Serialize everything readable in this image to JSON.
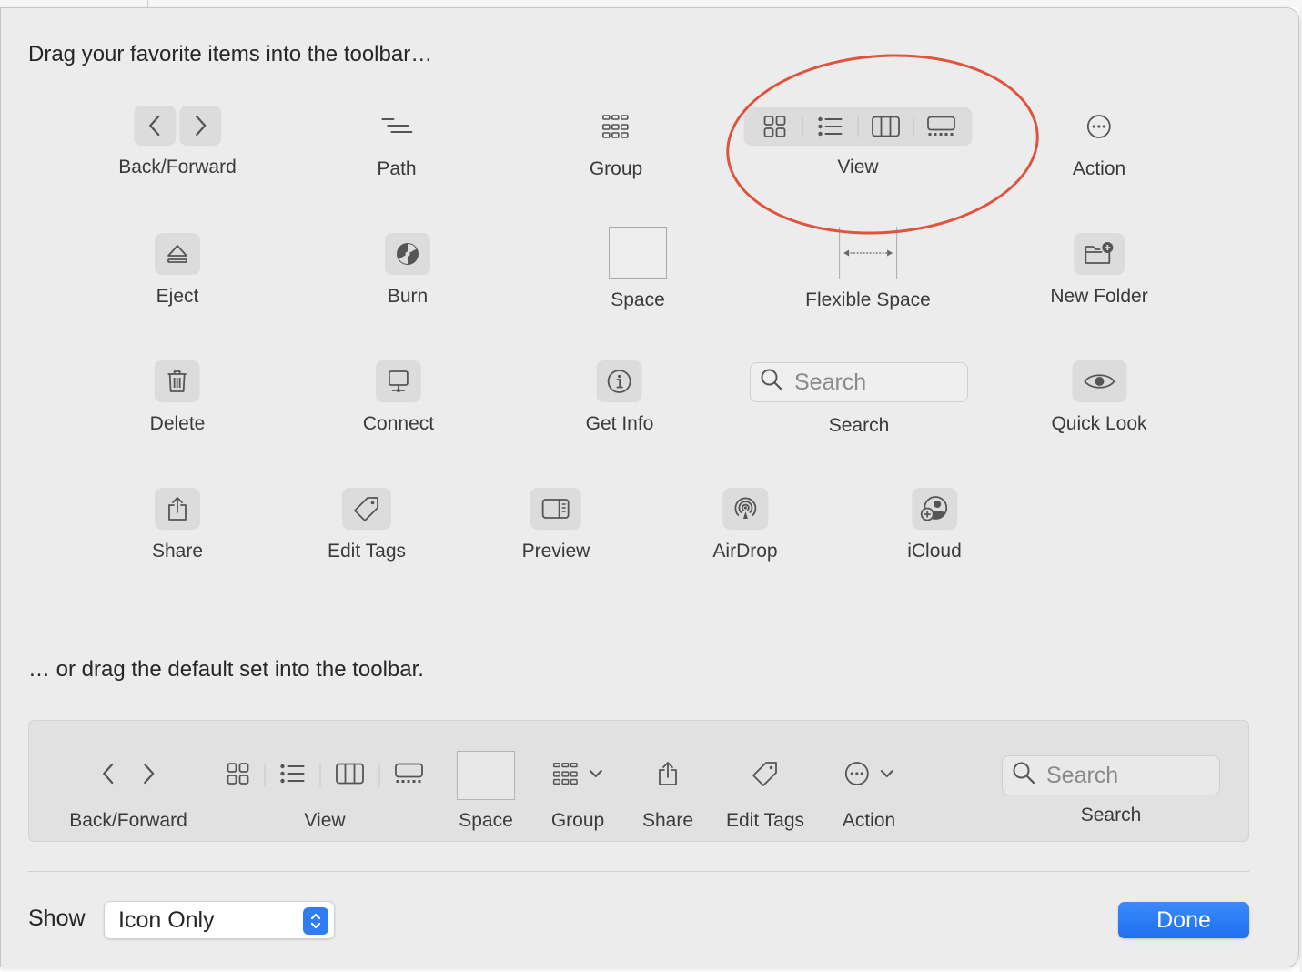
{
  "header": {
    "favorites_text": "Drag your favorite items into the toolbar…",
    "default_text": "… or drag the default set into the toolbar."
  },
  "items": {
    "back_forward": "Back/Forward",
    "path": "Path",
    "group": "Group",
    "view": "View",
    "action": "Action",
    "eject": "Eject",
    "burn": "Burn",
    "space": "Space",
    "flexible_space": "Flexible Space",
    "new_folder": "New Folder",
    "delete": "Delete",
    "connect": "Connect",
    "get_info": "Get Info",
    "search": "Search",
    "search_placeholder": "Search",
    "quick_look": "Quick Look",
    "share": "Share",
    "edit_tags": "Edit Tags",
    "preview": "Preview",
    "airdrop": "AirDrop",
    "icloud": "iCloud"
  },
  "default_set": {
    "back_forward": "Back/Forward",
    "view": "View",
    "space": "Space",
    "group": "Group",
    "share": "Share",
    "edit_tags": "Edit Tags",
    "action": "Action",
    "search": "Search",
    "search_placeholder": "Search"
  },
  "footer": {
    "show_label": "Show",
    "show_value": "Icon Only",
    "done_label": "Done"
  },
  "colors": {
    "highlight_circle": "#e0533c",
    "accent": "#2f7cf6"
  }
}
